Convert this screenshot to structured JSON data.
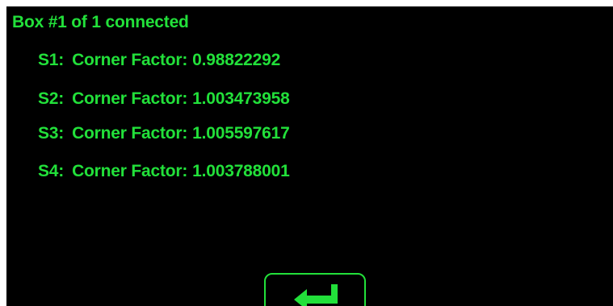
{
  "status_text": "Box #1 of 1 connected",
  "sensors": [
    {
      "id": "S1:",
      "label": "Corner Factor:",
      "value": "0.98822292"
    },
    {
      "id": "S2:",
      "label": "Corner Factor:",
      "value": "1.003473958"
    },
    {
      "id": "S3:",
      "label": "Corner Factor:",
      "value": "1.005597617"
    },
    {
      "id": "S4:",
      "label": "Corner Factor:",
      "value": "1.003788001"
    }
  ],
  "enter_button": {
    "icon": "enter-arrow-icon"
  },
  "colors": {
    "text": "#22e03a",
    "background": "#000000"
  }
}
